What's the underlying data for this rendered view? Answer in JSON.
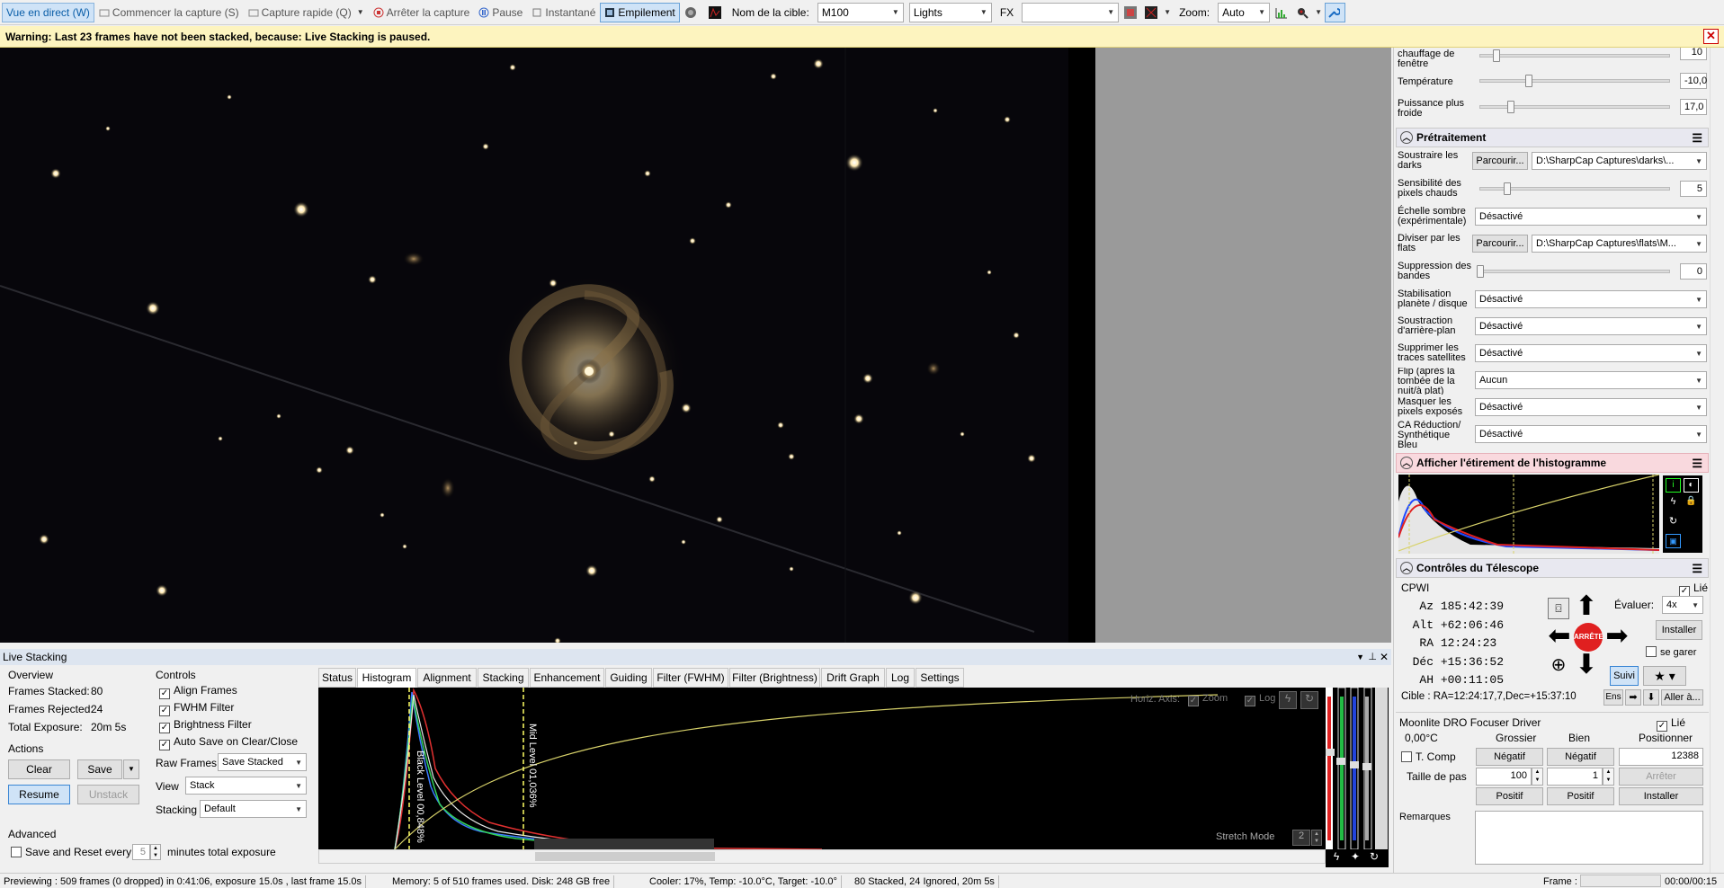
{
  "toolbar": {
    "live_view": "Vue en direct (W)",
    "start_capture": "Commencer la capture (S)",
    "quick_capture": "Capture rapide (Q)",
    "stop_capture": "Arrêter la capture",
    "pause": "Pause",
    "snapshot": "Instantané",
    "stacking": "Empilement",
    "target_label": "Nom de la cible:",
    "target_value": "M100",
    "frame_type": "Lights",
    "fx_label": "FX",
    "zoom_label": "Zoom:",
    "zoom_value": "Auto"
  },
  "warning": {
    "text": "Warning: Last 23 frames have not been stacked, because: Live Stacking is paused.",
    "close": "✕"
  },
  "camera_controls": {
    "rows": [
      {
        "label": "chauffage de fenêtre",
        "value": "10"
      },
      {
        "label": "Température",
        "value": "-10,0"
      },
      {
        "label": "Puissance plus froide",
        "value": "17,0"
      }
    ]
  },
  "preprocessing": {
    "title": "Prétraitement",
    "subtract_darks_label": "Soustraire les darks",
    "browse": "Parcourir...",
    "darks_path": "D:\\SharpCap Captures\\darks\\...",
    "hot_pixel_label": "Sensibilité des pixels chauds",
    "hot_pixel_value": "5",
    "dark_scale_label": "Échelle sombre (expérimentale)",
    "dark_scale_value": "Désactivé",
    "flats_label": "Diviser par les flats",
    "flats_path": "D:\\SharpCap Captures\\flats\\M...",
    "banding_label": "Suppression des bandes",
    "banding_value": "0",
    "stabilization_label": "Stabilisation planète / disque",
    "stabilization_value": "Désactivé",
    "background_label": "Soustraction d'arrière-plan",
    "background_value": "Désactivé",
    "satellite_label": "Supprimer les traces satellites",
    "satellite_value": "Désactivé",
    "flip_label": "Flip (après la tombée de la nuit/à plat)",
    "flip_value": "Aucun",
    "overexposed_label": "Masquer les pixels exposés",
    "overexposed_value": "Désactivé",
    "ca_label": "CA Réduction/ Synthétique Bleu",
    "ca_value": "Désactivé"
  },
  "histogram_panel": {
    "title": "Afficher l'étirement de l'histogramme"
  },
  "telescope": {
    "title": "Contrôles du Télescope",
    "mount": "CPWI",
    "linked": "Lié",
    "az_label": "Az",
    "az": "185:42:39",
    "alt_label": "Alt",
    "alt": "+62:06:46",
    "ra_label": "RA",
    "ra": "12:24:23",
    "dec_label": "Déc",
    "dec": "+15:36:52",
    "ah_label": "AH",
    "ah": "+00:11:05",
    "rate_label": "Évaluer:",
    "rate_value": "4x",
    "install": "Installer",
    "park": "se garer",
    "track": "Suivi",
    "stop": "ARRÊTE",
    "target": "Cible : RA=12:24:17,7,Dec=+15:37:10",
    "set": "Ens",
    "goto": "Aller à..."
  },
  "focuser": {
    "title": "Moonlite DRO Focuser Driver",
    "linked": "Lié",
    "temp": "0,00°C",
    "coarse": "Grossier",
    "fine": "Bien",
    "position_label": "Positionner",
    "t_comp": "T. Comp",
    "negative": "Négatif",
    "position": "12388",
    "step_label": "Taille de pas",
    "coarse_step": "100",
    "fine_step": "1",
    "stop": "Arrêter",
    "positive": "Positif",
    "install": "Installer",
    "notes": "Remarques"
  },
  "live_stacking": {
    "title": "Live Stacking",
    "overview": "Overview",
    "stacked_label": "Frames Stacked:",
    "stacked": "80",
    "rejected_label": "Frames Rejected:",
    "rejected": "24",
    "exposure_label": "Total Exposure:",
    "exposure": "20m 5s",
    "actions": "Actions",
    "clear": "Clear",
    "save": "Save",
    "resume": "Resume",
    "unstack": "Unstack",
    "advanced": "Advanced",
    "save_reset": "Save and Reset every",
    "save_reset_value": "5",
    "minutes": "minutes total exposure",
    "controls": "Controls",
    "align": "Align Frames",
    "fwhm": "FWHM Filter",
    "brightness": "Brightness Filter",
    "autosave": "Auto Save on Clear/Close",
    "raw_label": "Raw Frames",
    "raw_value": "Save Stacked",
    "view_label": "View",
    "view_value": "Stack",
    "stacking_label": "Stacking",
    "stacking_value": "Default",
    "tabs": [
      "Status",
      "Histogram",
      "Alignment",
      "Stacking",
      "Enhancement",
      "Guiding",
      "Filter (FWHM)",
      "Filter (Brightness)",
      "Drift Graph",
      "Log",
      "Settings"
    ],
    "horiz_axis": "Horiz. Axis:",
    "zoom": "Zoom",
    "log": "Log",
    "black_level": "Black Level 00,848%",
    "mid_level": "Mid Level 01,036%",
    "stretch_mode": "Stretch Mode",
    "stretch_value": "2"
  },
  "status_bar": {
    "preview": "Previewing : 509 frames (0 dropped) in 0:41:06, exposure 15.0s , last frame 15.0s",
    "memory": "Memory: 5 of 510 frames used. Disk: 248 GB free",
    "cooler": "Cooler: 17%, Temp: -10.0°C, Target: -10.0°",
    "stacked": "80 Stacked, 24 Ignored, 20m 5s",
    "frame_label": "Frame :",
    "time": "00:00/00:15"
  },
  "colors": {
    "accent": "#0a5ea8",
    "warning_bg": "#fdf4bf",
    "stop_red": "#e02020"
  }
}
